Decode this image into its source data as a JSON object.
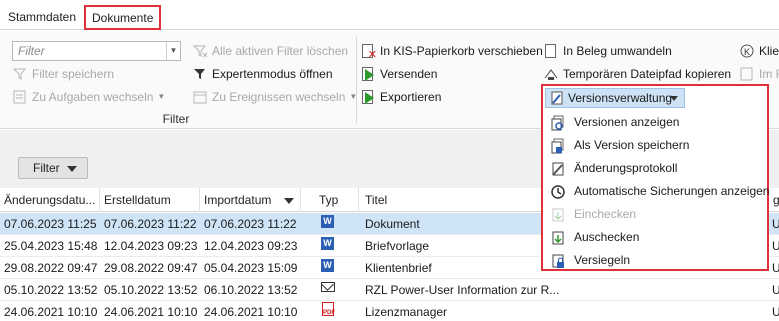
{
  "tabs": [
    {
      "label": "Stammdaten",
      "active": false
    },
    {
      "label": "Dokumente",
      "active": true
    }
  ],
  "ribbon": {
    "filter_group": {
      "label": "Filter",
      "filter_placeholder": "Filter",
      "clear_filters": "Alle aktiven Filter löschen",
      "save_filter": "Filter speichern",
      "expert_mode": "Expertenmodus öffnen",
      "switch_tasks": "Zu Aufgaben wechseln",
      "switch_events": "Zu Ereignissen wechseln"
    },
    "actions": {
      "kis_trash": "In KIS-Papierkorb verschieben",
      "send": "Versenden",
      "export": "Exportieren",
      "convert_receipt": "In Beleg umwandeln",
      "temp_path": "Temporären Dateipfad kopieren",
      "client_cut": "Klier",
      "pdf_cut": "Im F",
      "versioning": "Versionsverwaltung"
    }
  },
  "versions_menu": [
    {
      "label": "Versionen anzeigen",
      "icon": "versions-icon",
      "enabled": true
    },
    {
      "label": "Als Version speichern",
      "icon": "save-version-icon",
      "enabled": true
    },
    {
      "label": "Änderungsprotokoll",
      "icon": "changelog-icon",
      "enabled": true
    },
    {
      "label": "Automatische Sicherungen anzeigen",
      "icon": "history-clock-icon",
      "enabled": true
    },
    {
      "label": "Einchecken",
      "icon": "checkin-icon",
      "enabled": false
    },
    {
      "label": "Auschecken",
      "icon": "checkout-icon",
      "enabled": true
    },
    {
      "label": "Versiegeln",
      "icon": "seal-lock-icon",
      "enabled": true
    }
  ],
  "filter_button": "Filter",
  "table": {
    "columns": [
      "Änderungsdatu...",
      "Erstelldatum",
      "Importdatum",
      "Typ",
      "Titel",
      "g"
    ],
    "rows": [
      {
        "changed": "07.06.2023 11:25",
        "created": "07.06.2023 11:22",
        "imported": "07.06.2023 11:22",
        "type": "word",
        "title": "Dokument",
        "extra": "Ur",
        "selected": true
      },
      {
        "changed": "25.04.2023 15:48",
        "created": "12.04.2023 09:23",
        "imported": "12.04.2023 09:23",
        "type": "word",
        "title": "Briefvorlage",
        "extra": "Ur",
        "selected": false
      },
      {
        "changed": "29.08.2022 09:47",
        "created": "29.08.2022 09:47",
        "imported": "05.04.2023 15:09",
        "type": "word",
        "title": "Klientenbrief",
        "extra": "Ur",
        "selected": false
      },
      {
        "changed": "05.10.2022 13:52",
        "created": "05.10.2022 13:52",
        "imported": "06.10.2022 13:52",
        "type": "mail",
        "title": "RZL Power-User Information zur R...",
        "extra": "Ur",
        "selected": false
      },
      {
        "changed": "24.06.2021 10:10",
        "created": "24.06.2021 10:10",
        "imported": "24.06.2021 10:10",
        "type": "pdf",
        "title": "Lizenzmanager",
        "extra": "Ur",
        "selected": false
      }
    ]
  },
  "colors": {
    "highlight_border": "#e0303a",
    "selection": "#cfe4f7",
    "word_blue": "#2b5fb4",
    "pdf_red": "#d42020"
  }
}
